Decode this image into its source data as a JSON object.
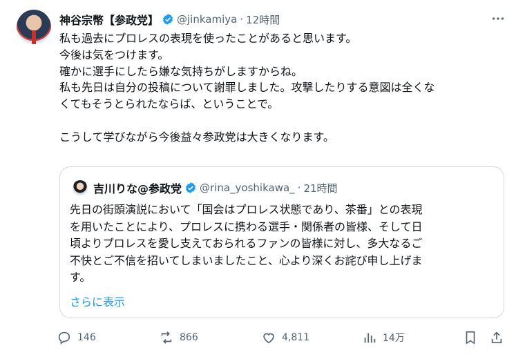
{
  "tweet": {
    "author_name": "神谷宗幣【参政党】",
    "handle": "@jinkamiya",
    "separator": "·",
    "time": "12時間",
    "body_lines": [
      "私も過去にプロレスの表現を使ったことがあると思います。",
      "今後は気をつけます。",
      "確かに選手にしたら嫌な気持ちがしますからね。",
      "私も先日は自分の投稿について謝罪しました。攻撃したりする意図は全くな",
      "くてもそうとられたならば、ということで。",
      "",
      "こうして学びながら今後益々参政党は大きくなります。"
    ]
  },
  "quote": {
    "author_name": "吉川りな@参政党",
    "handle": "@rina_yoshikawa_",
    "separator": "·",
    "time": "21時間",
    "body_lines": [
      "先日の街頭演説において「国会はプロレス状態であり、茶番」との表現",
      "を用いたことにより、プロレスに携わる選手・関係者の皆様、そして日",
      "頃よりプロレスを愛し支えておられるファンの皆様に対し、多大なるご",
      "不快とご不信を招いてしまいましたこと、心より深くお詫び申し上げま",
      "す。"
    ],
    "show_more": "さらに表示"
  },
  "actions": {
    "replies": "146",
    "reposts": "866",
    "likes": "4,811",
    "views": "14万"
  },
  "colors": {
    "text": "#0f1419",
    "secondary": "#536471",
    "accent": "#1d9bf0",
    "border": "#cfd9de"
  },
  "icons": [
    "verified-badge-icon",
    "more-options-icon",
    "reply-icon",
    "repost-icon",
    "like-icon",
    "views-icon",
    "bookmark-icon",
    "share-icon"
  ]
}
